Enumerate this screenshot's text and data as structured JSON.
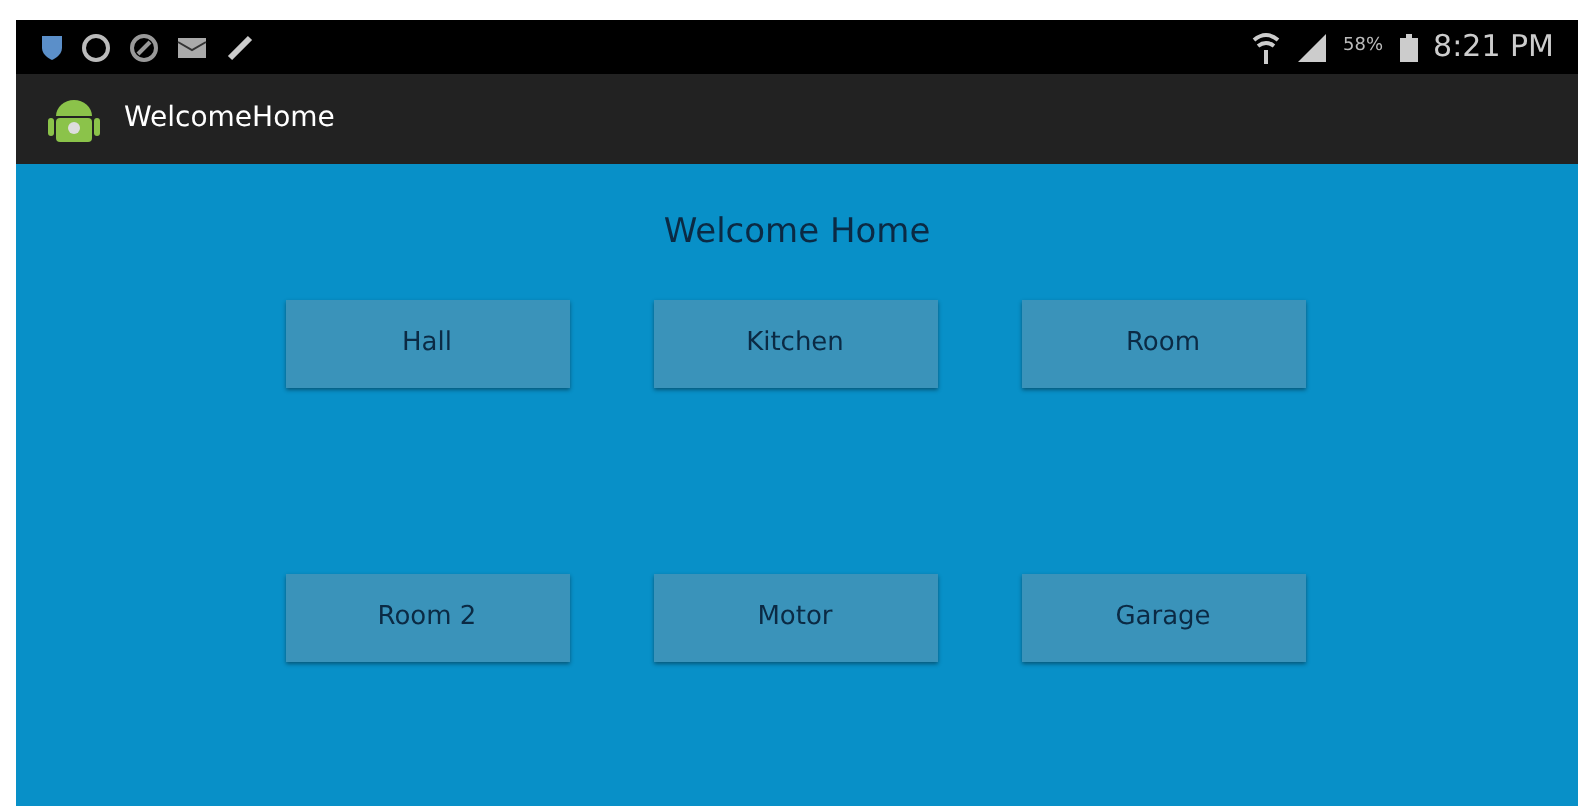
{
  "status_bar": {
    "battery": "58%",
    "time": "8:21 PM"
  },
  "app_bar": {
    "title": "WelcomeHome"
  },
  "heading": "Welcome Home",
  "buttons": [
    {
      "label": "Hall"
    },
    {
      "label": "Kitchen"
    },
    {
      "label": "Room"
    },
    {
      "label": "Room 2"
    },
    {
      "label": "Motor"
    },
    {
      "label": "Garage"
    }
  ]
}
